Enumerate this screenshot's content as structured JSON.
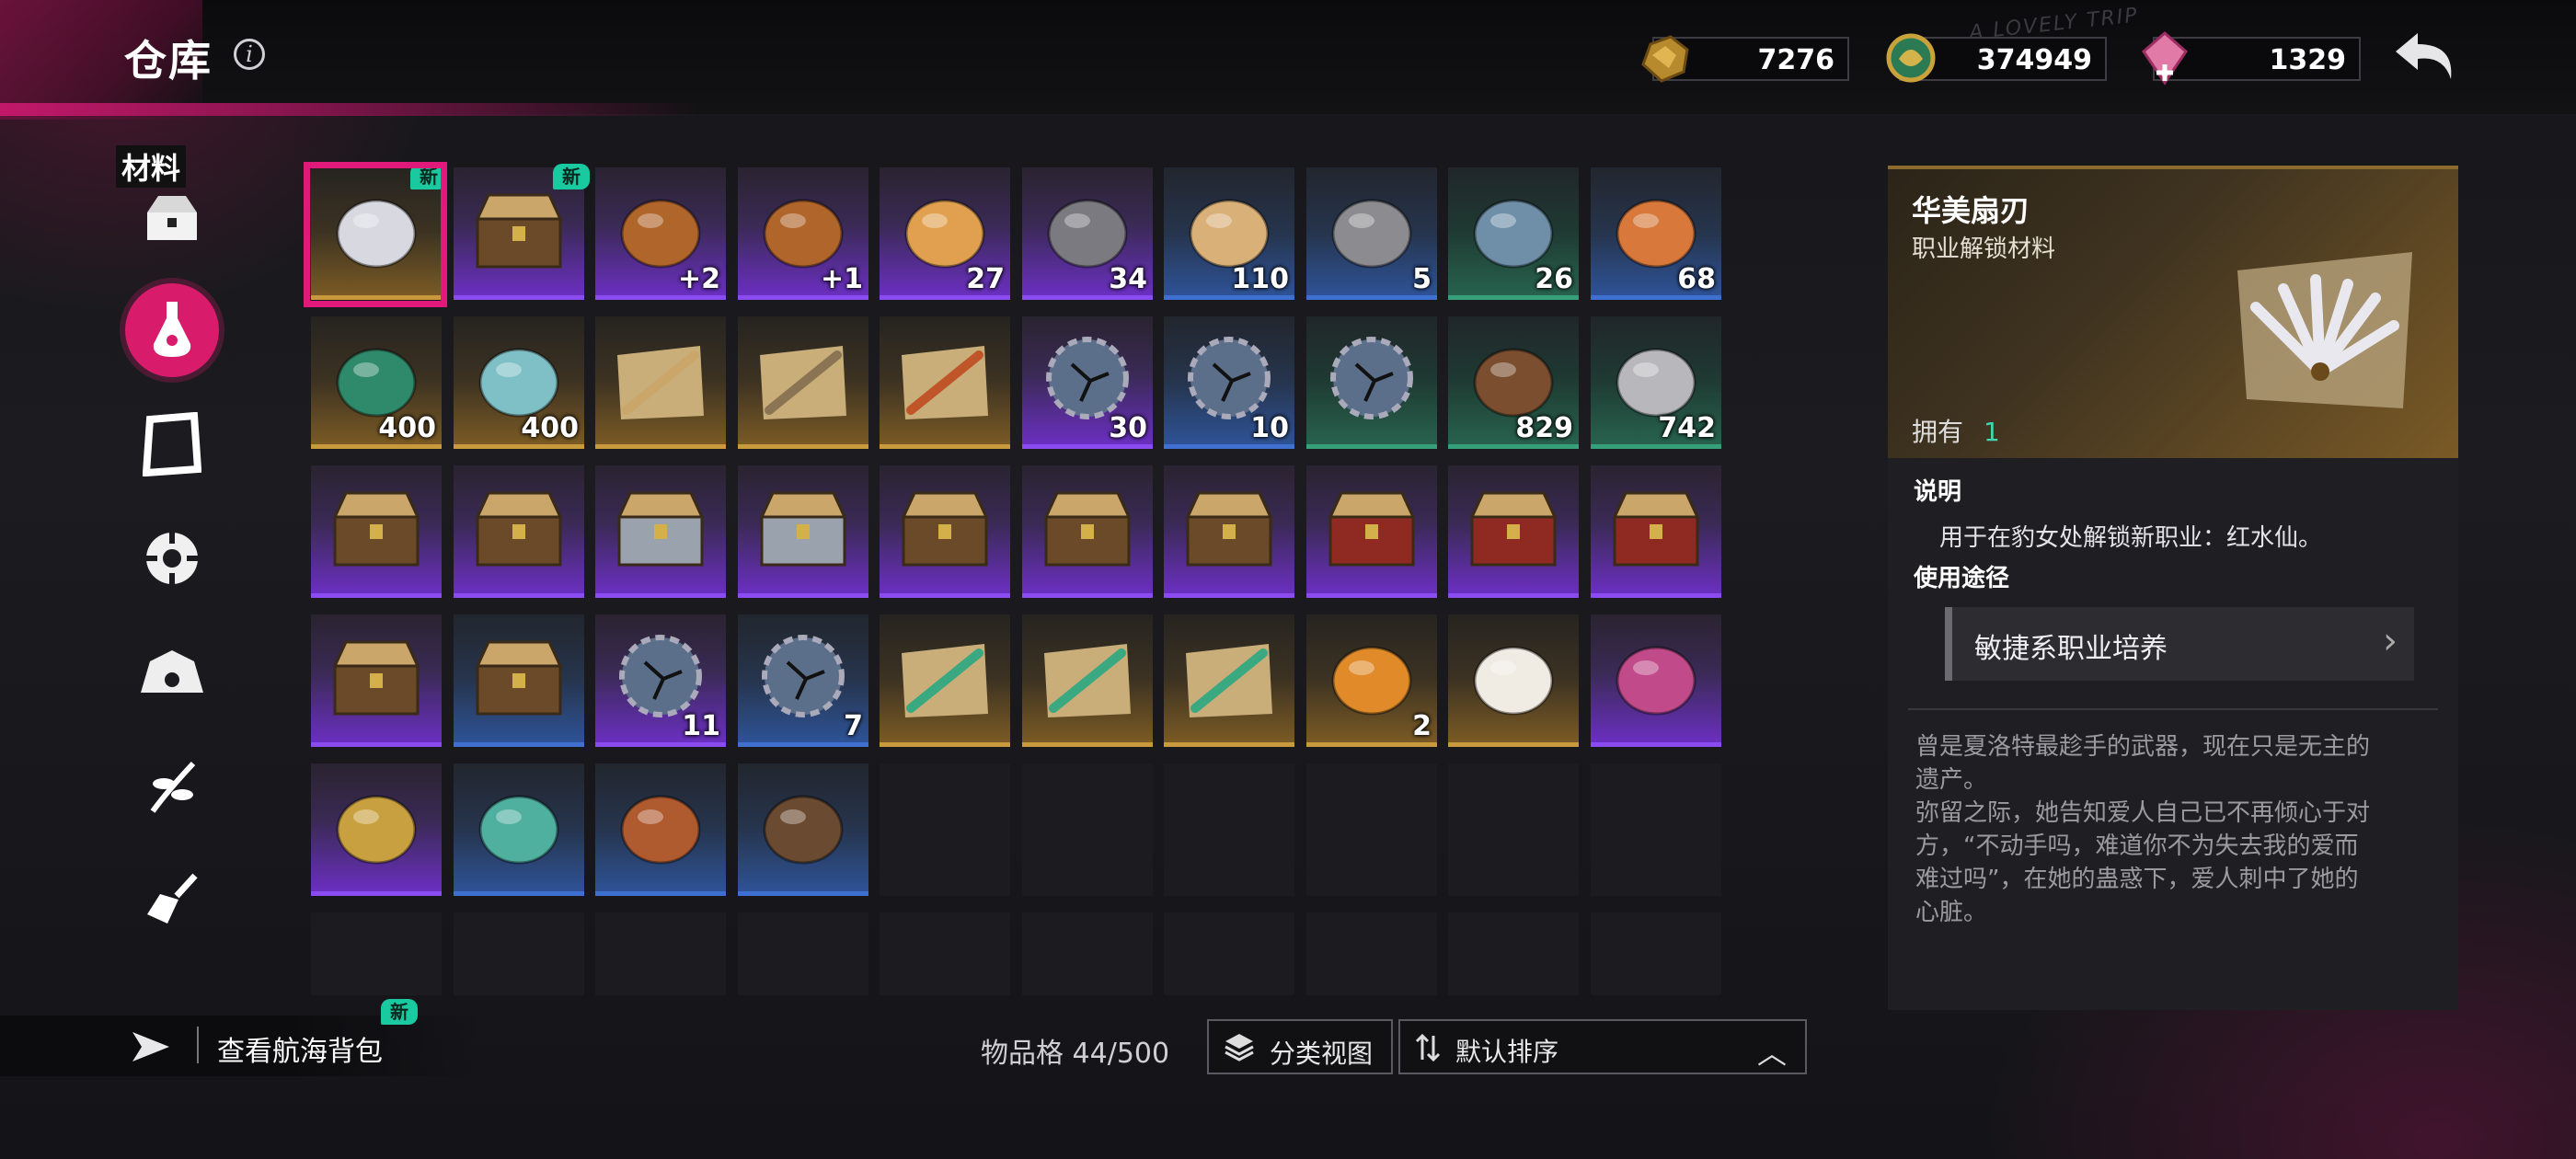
{
  "header": {
    "title": "仓库",
    "info_icon": "info-icon",
    "decor_text": "A LOVELY TRIP",
    "currencies": [
      {
        "name": "gold-ore",
        "value": "7276",
        "color": "#c99a3c"
      },
      {
        "name": "dragon-coin",
        "value": "374949",
        "color": "#3aa070"
      },
      {
        "name": "pink-gem",
        "value": "1329",
        "color": "#e07aa8"
      }
    ],
    "back_icon": "back-arrow-icon"
  },
  "sidebar": {
    "active_label": "材料",
    "items": [
      {
        "icon": "chest-icon",
        "active": false
      },
      {
        "icon": "potion-icon",
        "active": true
      },
      {
        "icon": "card-frame-icon",
        "active": false
      },
      {
        "icon": "gear-wheel-icon",
        "active": false
      },
      {
        "icon": "helm-icon",
        "active": false
      },
      {
        "icon": "herb-icon",
        "active": false
      },
      {
        "icon": "shovel-icon",
        "active": false
      }
    ]
  },
  "grid": {
    "new_label": "新",
    "rows": [
      [
        {
          "icon": "fan-blade-icon",
          "rarity": "gold",
          "qty": "",
          "new": true,
          "selected": true
        },
        {
          "icon": "chest-icon",
          "rarity": "purple",
          "qty": "",
          "new": true
        },
        {
          "icon": "horn-icon",
          "rarity": "purple",
          "qty": "+2"
        },
        {
          "icon": "horn-icon",
          "rarity": "purple",
          "qty": "+1"
        },
        {
          "icon": "pancake-icon",
          "rarity": "purple",
          "qty": "27"
        },
        {
          "icon": "seeds-icon",
          "rarity": "purple",
          "qty": "34"
        },
        {
          "icon": "ginger-icon",
          "rarity": "blue",
          "qty": "110"
        },
        {
          "icon": "statue-icon",
          "rarity": "blue",
          "qty": "5"
        },
        {
          "icon": "hook-icon",
          "rarity": "green",
          "qty": "26"
        },
        {
          "icon": "tag-icon",
          "rarity": "blue",
          "qty": "68"
        }
      ],
      [
        {
          "icon": "book-icon",
          "rarity": "gold",
          "qty": "400"
        },
        {
          "icon": "shell-icon",
          "rarity": "gold",
          "qty": "400"
        },
        {
          "icon": "broom-scroll-icon",
          "rarity": "gold",
          "qty": ""
        },
        {
          "icon": "sword-scroll-icon",
          "rarity": "gold",
          "qty": ""
        },
        {
          "icon": "orb-scroll-icon",
          "rarity": "gold",
          "qty": ""
        },
        {
          "icon": "cracked-gear-icon",
          "rarity": "purple",
          "qty": "30"
        },
        {
          "icon": "cracked-gear-icon",
          "rarity": "blue",
          "qty": "10"
        },
        {
          "icon": "cracked-gear-icon",
          "rarity": "green",
          "qty": ""
        },
        {
          "icon": "wood-icon",
          "rarity": "green",
          "qty": "829"
        },
        {
          "icon": "stone-icon",
          "rarity": "green",
          "qty": "742"
        }
      ],
      [
        {
          "icon": "chest-icon",
          "rarity": "purple",
          "qty": ""
        },
        {
          "icon": "chest-icon",
          "rarity": "purple",
          "qty": ""
        },
        {
          "icon": "silver-chest-icon",
          "rarity": "purple",
          "qty": ""
        },
        {
          "icon": "silver-chest-icon",
          "rarity": "purple",
          "qty": ""
        },
        {
          "icon": "chest-icon",
          "rarity": "purple",
          "qty": ""
        },
        {
          "icon": "chest-icon",
          "rarity": "purple",
          "qty": ""
        },
        {
          "icon": "chest-icon",
          "rarity": "purple",
          "qty": ""
        },
        {
          "icon": "red-chest-icon",
          "rarity": "purple",
          "qty": ""
        },
        {
          "icon": "red-chest-icon",
          "rarity": "purple",
          "qty": ""
        },
        {
          "icon": "red-chest-icon",
          "rarity": "purple",
          "qty": ""
        }
      ],
      [
        {
          "icon": "chest-icon",
          "rarity": "purple",
          "qty": ""
        },
        {
          "icon": "chest-icon",
          "rarity": "blue",
          "qty": ""
        },
        {
          "icon": "cracked-gear-icon",
          "rarity": "purple",
          "qty": "11"
        },
        {
          "icon": "cracked-gear-icon",
          "rarity": "blue",
          "qty": "7"
        },
        {
          "icon": "rocket-scroll-icon",
          "rarity": "gold",
          "qty": ""
        },
        {
          "icon": "rocket-scroll-icon",
          "rarity": "gold",
          "qty": ""
        },
        {
          "icon": "rocket-scroll-icon",
          "rarity": "gold",
          "qty": ""
        },
        {
          "icon": "fire-staff-icon",
          "rarity": "gold",
          "qty": "2"
        },
        {
          "icon": "lucky-cat-icon",
          "rarity": "gold",
          "qty": ""
        },
        {
          "icon": "necklace-icon",
          "rarity": "purple",
          "qty": ""
        }
      ],
      [
        {
          "icon": "locket-icon",
          "rarity": "purple",
          "qty": ""
        },
        {
          "icon": "bottle-icon",
          "rarity": "blue",
          "qty": ""
        },
        {
          "icon": "tome-icon",
          "rarity": "blue",
          "qty": ""
        },
        {
          "icon": "drawer-icon",
          "rarity": "blue",
          "qty": ""
        },
        {
          "icon": "",
          "rarity": "empty",
          "qty": ""
        },
        {
          "icon": "",
          "rarity": "empty",
          "qty": ""
        },
        {
          "icon": "",
          "rarity": "empty",
          "qty": ""
        },
        {
          "icon": "",
          "rarity": "empty",
          "qty": ""
        },
        {
          "icon": "",
          "rarity": "empty",
          "qty": ""
        },
        {
          "icon": "",
          "rarity": "empty",
          "qty": ""
        }
      ],
      [
        {
          "icon": "",
          "rarity": "empty",
          "qty": ""
        },
        {
          "icon": "",
          "rarity": "empty",
          "qty": ""
        },
        {
          "icon": "",
          "rarity": "empty",
          "qty": ""
        },
        {
          "icon": "",
          "rarity": "empty",
          "qty": ""
        },
        {
          "icon": "",
          "rarity": "empty",
          "qty": ""
        },
        {
          "icon": "",
          "rarity": "empty",
          "qty": ""
        },
        {
          "icon": "",
          "rarity": "empty",
          "qty": ""
        },
        {
          "icon": "",
          "rarity": "empty",
          "qty": ""
        },
        {
          "icon": "",
          "rarity": "empty",
          "qty": ""
        },
        {
          "icon": "",
          "rarity": "empty",
          "qty": ""
        }
      ]
    ]
  },
  "detail": {
    "name": "华美扇刃",
    "type": "职业解锁材料",
    "owned_label": "拥有",
    "owned_value": "1",
    "desc_title": "说明",
    "desc": "用于在豹女处解锁新职业：红水仙。",
    "usage_title": "使用途径",
    "usage_button": "敏捷系职业培养",
    "lore": "曾是夏洛特最趁手的武器，现在只是无主的\n遗产。\n弥留之际，她告知爱人自己已不再倾心于对\n方，“不动手吗，难道你不为失去我的爱而\n难过吗”，在她的蛊惑下，爱人刺中了她的\n心脏。"
  },
  "footer": {
    "voyage_label": "查看航海背包",
    "voyage_new": "新",
    "slots_label": "物品格 44/500",
    "category_view": "分类视图",
    "sort_label": "默认排序"
  }
}
